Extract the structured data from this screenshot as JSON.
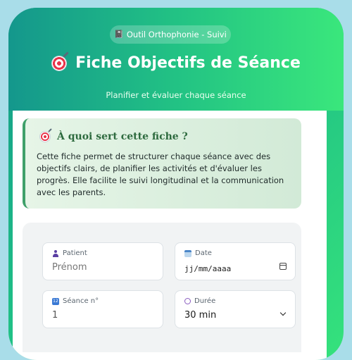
{
  "header": {
    "badge_icon": "notebook-icon",
    "badge": "Outil Orthophonie - Suivi",
    "title_icon": "target-icon",
    "title": "Fiche Objectifs de Séance",
    "subtitle": "Planifier et évaluer chaque séance"
  },
  "info": {
    "icon": "target-icon",
    "title": "À quoi sert cette fiche ?",
    "text": "Cette fiche permet de structurer chaque séance avec des objectifs clairs, de planifier les activités et d'évaluer les progrès. Elle facilite le suivi longitudinal et la communication avec les parents."
  },
  "form": {
    "patient": {
      "label": "Patient",
      "placeholder": "Prénom"
    },
    "date": {
      "label": "Date",
      "value": "jj/mm/aaaa"
    },
    "session": {
      "label": "Séance n°",
      "value": "1"
    },
    "duration": {
      "label": "Durée",
      "selected": "30 min"
    }
  },
  "colors": {
    "accent_start": "#14978c",
    "accent_end": "#3ae77c",
    "info_border": "#3fa06a",
    "info_title": "#2d6a3e",
    "page_bg": "#a9dde9"
  }
}
